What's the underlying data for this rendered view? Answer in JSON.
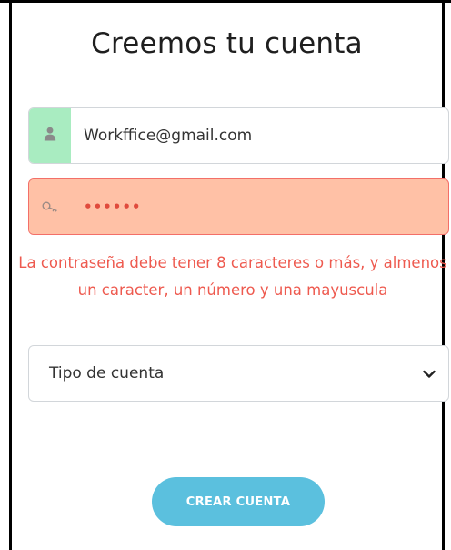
{
  "form": {
    "title": "Creemos tu cuenta",
    "email": {
      "value": "Workffice@gmail.com",
      "icon": "user-icon"
    },
    "password": {
      "value": "••••••",
      "icon": "key-icon"
    },
    "password_error": "La contraseña debe tener 8 caracteres o más, y almenos un caracter, un número y una mayuscula",
    "account_type": {
      "selected": "Tipo de cuenta",
      "icon": "chevron-down-icon"
    },
    "submit_label": "CREAR CUENTA"
  },
  "colors": {
    "email_addon_bg": "#a9ecc1",
    "password_field_bg": "#ffc1a6",
    "error_text": "#ee5a4f",
    "button_bg": "#5bc0de"
  }
}
